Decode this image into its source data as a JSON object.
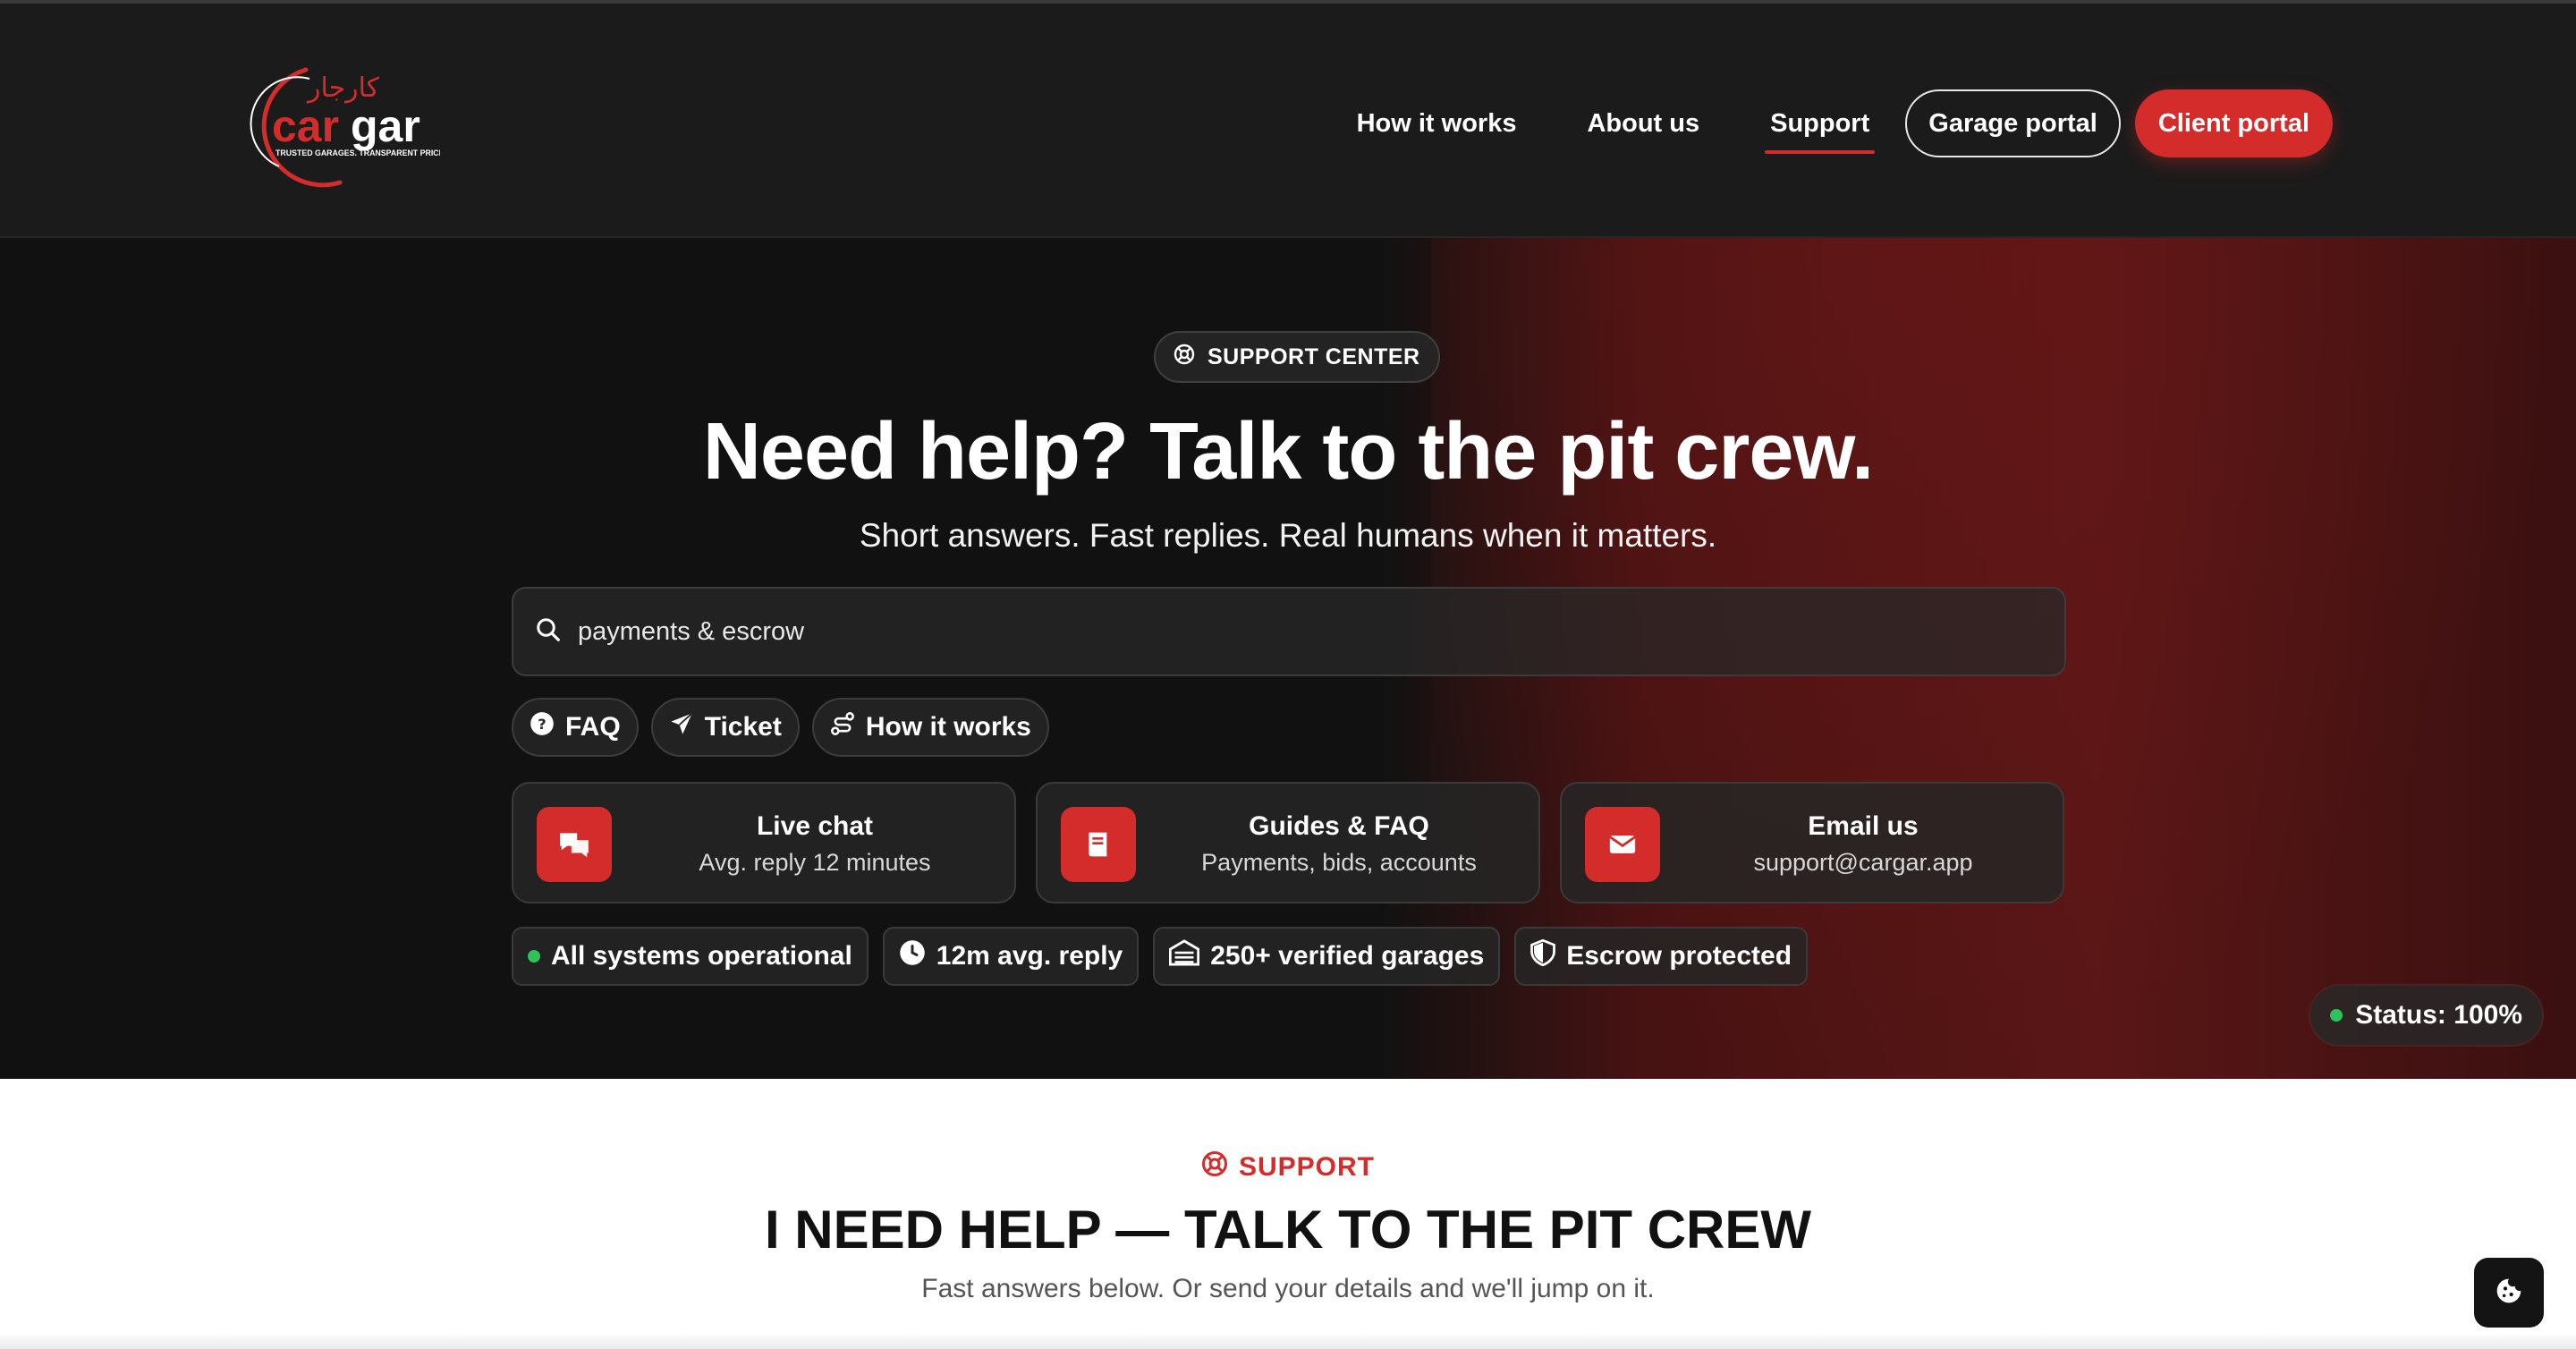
{
  "brand": {
    "name": "cargar",
    "arabic": "كارجار",
    "tagline": "TRUSTED GARAGES. TRANSPARENT PRICES",
    "accent_color": "#d42b2b"
  },
  "nav": {
    "links": [
      "How it works",
      "About us",
      "Support"
    ],
    "active": "Support",
    "garage_portal": "Garage portal",
    "client_portal": "Client portal"
  },
  "hero": {
    "badge": "SUPPORT CENTER",
    "badge_icon": "lifebuoy-icon",
    "title": "Need help? Talk to the pit crew.",
    "subtitle": "Short answers. Fast replies. Real humans when it matters.",
    "search_value": "payments & escrow",
    "chips": [
      {
        "label": "FAQ",
        "icon": "question-circle-icon"
      },
      {
        "label": "Ticket",
        "icon": "paper-plane-icon"
      },
      {
        "label": "How it works",
        "icon": "route-icon"
      }
    ],
    "cards": [
      {
        "title": "Live chat",
        "subtitle": "Avg. reply 12 minutes",
        "icon": "chat-bubbles-icon"
      },
      {
        "title": "Guides & FAQ",
        "subtitle": "Payments, bids, accounts",
        "icon": "book-icon"
      },
      {
        "title": "Email us",
        "subtitle": "support@cargar.app",
        "icon": "envelope-icon"
      }
    ],
    "stats": [
      {
        "label": "All systems operational",
        "icon": "status-dot"
      },
      {
        "label": "12m avg. reply",
        "icon": "clock-icon"
      },
      {
        "label": "250+ verified garages",
        "icon": "garage-icon"
      },
      {
        "label": "Escrow protected",
        "icon": "shield-icon"
      }
    ],
    "status_pill": "Status: 100%"
  },
  "support_section": {
    "eyebrow": "SUPPORT",
    "title": "I NEED HELP — TALK TO THE PIT CREW",
    "subtitle": "Fast answers below. Or send your details and we'll jump on it."
  },
  "cookie_button": {
    "icon": "cookie-icon"
  }
}
